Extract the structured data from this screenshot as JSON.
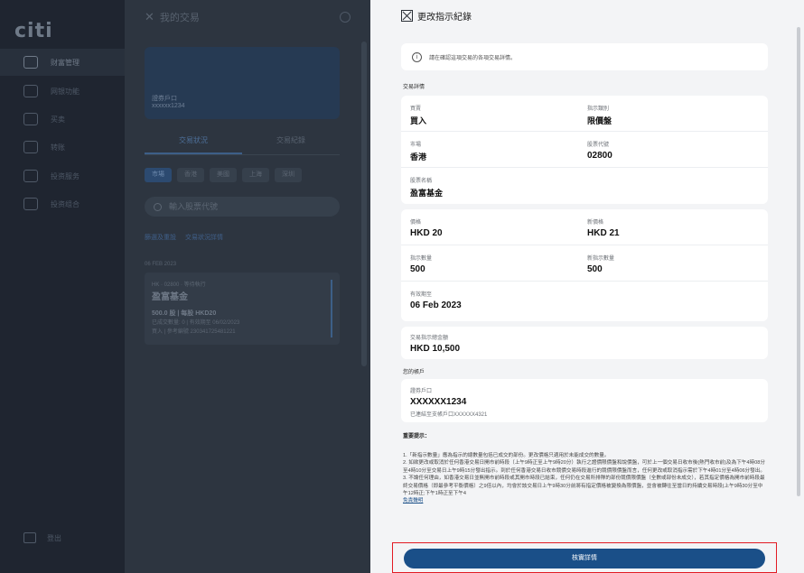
{
  "nav": {
    "logo": "citi",
    "items": [
      {
        "label": "财富管理",
        "active": true
      },
      {
        "label": "网银功能",
        "active": false
      },
      {
        "label": "买卖",
        "active": false
      },
      {
        "label": "转账",
        "active": false
      },
      {
        "label": "投资服务",
        "active": false
      },
      {
        "label": "投资组合",
        "active": false
      }
    ],
    "logout": "登出"
  },
  "mid": {
    "title": "我的交易",
    "account_label": "證券戶口",
    "account_number": "xxxxxx1234",
    "tabs": [
      "交易狀況",
      "交易紀錄"
    ],
    "markets": [
      "市場",
      "香港",
      "美國",
      "上海",
      "深圳"
    ],
    "search_placeholder": "輸入股票代號",
    "links": [
      "篩選及重設",
      "交易狀況詳情"
    ],
    "date_header": "06 FEB 2023",
    "order": {
      "code": "HK · 02800 · 等待執行",
      "name": "盈富基金",
      "qty_price": "500.0 股 | 每股 HKD20",
      "status": "已成交數量: 0 | 有效期至 06/02/2023",
      "ref": "買入 | 參考編號 230341725481221"
    }
  },
  "panel": {
    "title": "更改指示紀錄",
    "info": "請在確認這項交易的各項交易詳情。",
    "section_details": "交易詳情",
    "action_label": "買賣",
    "action_value": "買入",
    "order_type_label": "指示類別",
    "order_type_value": "限價盤",
    "market_label": "市場",
    "market_value": "香港",
    "code_label": "股票代號",
    "code_value": "02800",
    "name_label": "股票名稱",
    "name_value": "盈富基金",
    "price_label": "價格",
    "price_value": "HKD 20",
    "new_price_label": "新價格",
    "new_price_value": "HKD 21",
    "qty_label": "指示數量",
    "qty_value": "500",
    "new_qty_label": "新指示數量",
    "new_qty_value": "500",
    "valid_label": "有效期至",
    "valid_value": "06 Feb 2023",
    "amount_label": "交易指示總金額",
    "amount_value": "HKD 10,500",
    "section_account": "您的帳戶",
    "acct_label": "證券戶口",
    "acct_value": "XXXXXX1234",
    "acct_note": "已連結至支帳戶口XXXXXX4321",
    "notes_header": "重要提示：",
    "note1": "1.「新指示數量」應為指示的總數量包括已成交的部份。更改價格只適用於未能成交的數量。",
    "note2": "2. 如欲更改或取消於任何香港交易日開市前時段（上午9時正至上午9時20分）執行之證價限價盤和說價盤，可於上一個交易日收市後(熱門收市前)及為下午4時08分至4時10分至交易日上午9時15分發出指示。到於任何香港交易日收市競價交易時段進行的競價限價盤而言，任何更改或取消指示需於下午4時01分至4時06分發出。",
    "note3": "3. 不論任何理由，如香港交易日並無開市前時段或其開市時段已結束，任何仍在交易所排隊的部份競價限價盤（全數或部份未成交），若其指定價格為開市前時段最終交易價格（即最參考平衡價格）之9倍以內，均會於該交易日上午9時30分前將有指定價格被變換為限價盤，並會被轉往至當日的持續交易時段(上午9時30分至中午12時正;下午1時正至下午4",
    "note_link": "免責聲明",
    "cta": "核實詳情"
  }
}
